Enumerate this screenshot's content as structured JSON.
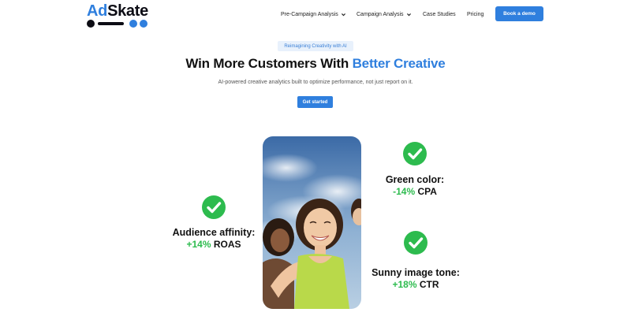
{
  "brand": {
    "name_part1": "Ad",
    "name_part2": "Skate",
    "colors": {
      "primary": "#2f7fde",
      "dark": "#0c0c14",
      "green": "#2dbb4e"
    }
  },
  "nav": {
    "items": [
      {
        "label": "Pre-Campaign Analysis",
        "has_dropdown": true
      },
      {
        "label": "Campaign Analysis",
        "has_dropdown": true
      },
      {
        "label": "Case Studies",
        "has_dropdown": false
      },
      {
        "label": "Pricing",
        "has_dropdown": false
      }
    ],
    "cta_label": "Book a demo"
  },
  "hero": {
    "badge": "Reimagining Creativity with AI",
    "headline_prefix": "Win More Customers With ",
    "headline_accent": "Better Creative",
    "subheadline": "AI-powered creative analytics built to optimize performance, not just report on it.",
    "cta_label": "Get started"
  },
  "stats": [
    {
      "label": "Green color:",
      "delta": "-14%",
      "metric": "CPA",
      "icon": "check-circle-icon"
    },
    {
      "label": "Audience affinity:",
      "delta": "+14%",
      "metric": "ROAS",
      "icon": "check-circle-icon"
    },
    {
      "label": "Sunny image tone:",
      "delta": "+18%",
      "metric": "CTR",
      "icon": "check-circle-icon"
    }
  ]
}
